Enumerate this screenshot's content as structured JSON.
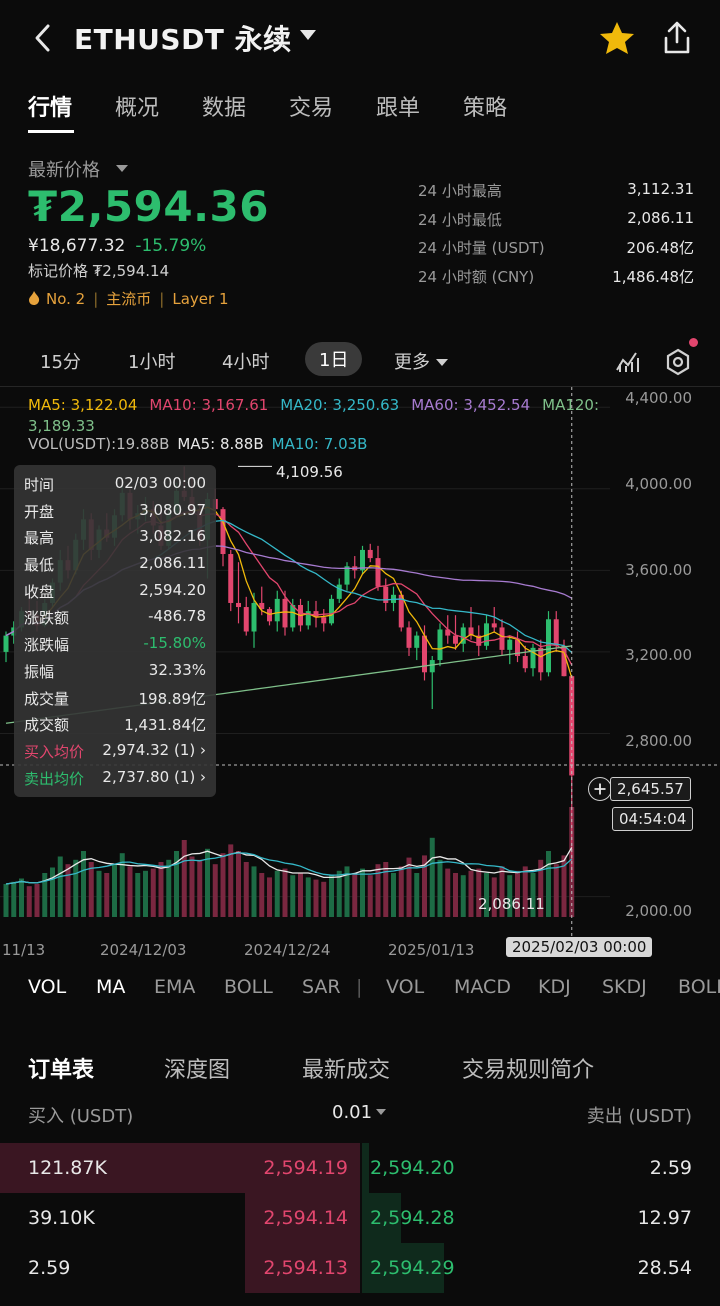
{
  "header": {
    "title": "ETHUSDT 永续"
  },
  "tabs": [
    "行情",
    "概况",
    "数据",
    "交易",
    "跟单",
    "策略"
  ],
  "ticker": {
    "latest_label": "最新价格",
    "last_price": "₮2,594.36",
    "cny_price": "¥18,677.32",
    "change_pct": "-15.79%",
    "mark_price": "标记价格 ₮2,594.14",
    "tag_rank": "No. 2",
    "tag_mainstream": "主流币",
    "tag_layer": "Layer 1",
    "sep": "|"
  },
  "stats": [
    {
      "label": "24 小时最高",
      "value": "3,112.31"
    },
    {
      "label": "24 小时最低",
      "value": "2,086.11"
    },
    {
      "label": "24 小时量 (USDT)",
      "value": "206.48亿"
    },
    {
      "label": "24 小时额 (CNY)",
      "value": "1,486.48亿"
    }
  ],
  "periods": {
    "p1": "15分",
    "p2": "1小时",
    "p3": "4小时",
    "p4": "1日",
    "more": "更多"
  },
  "ma_legend": {
    "ma5": "MA5: 3,122.04",
    "ma10": "MA10: 3,167.61",
    "ma20": "MA20: 3,250.63",
    "ma60": "MA60: 3,452.54",
    "ma120": "MA120: 3,189.33"
  },
  "vol_legend": {
    "vol": "VOL(USDT):19.88B",
    "ma5": "MA5: 8.88B",
    "ma10": "MA10: 7.03B"
  },
  "tooltip": [
    {
      "label": "时间",
      "value": "02/03 00:00"
    },
    {
      "label": "开盘",
      "value": "3,080.97"
    },
    {
      "label": "最高",
      "value": "3,082.16"
    },
    {
      "label": "最低",
      "value": "2,086.11"
    },
    {
      "label": "收盘",
      "value": "2,594.20"
    },
    {
      "label": "涨跌额",
      "value": "-486.78"
    },
    {
      "label": "涨跌幅",
      "value": "-15.80%"
    },
    {
      "label": "振幅",
      "value": "32.33%"
    },
    {
      "label": "成交量",
      "value": "198.89亿"
    },
    {
      "label": "成交额",
      "value": "1,431.84亿"
    },
    {
      "label": "买入均价",
      "value": "2,974.32 (1) ›"
    },
    {
      "label": "卖出均价",
      "value": "2,737.80 (1) ›"
    }
  ],
  "chart_labels": {
    "high": "4,109.56",
    "low": "2,086.11",
    "cross_price": "2,645.57",
    "cross_time": "04:54:04",
    "x_highlight": "2025/02/03 00:00"
  },
  "y_axis": [
    "4,400.00",
    "4,000.00",
    "3,600.00",
    "3,200.00",
    "2,800.00",
    "2,000.00"
  ],
  "x_axis": [
    "11/13",
    "2024/12/03",
    "2024/12/24",
    "2025/01/13"
  ],
  "indicators": [
    "VOL",
    "MA",
    "EMA",
    "BOLL",
    "SAR",
    "|",
    "VOL",
    "MACD",
    "KDJ",
    "SKDJ",
    "BOLL"
  ],
  "book_tabs": [
    "订单表",
    "深度图",
    "最新成交",
    "交易规则简介"
  ],
  "book_head": {
    "bid": "买入 (USDT)",
    "tick": "0.01",
    "ask": "卖出 (USDT)"
  },
  "book": [
    {
      "bid_qty": "121.87K",
      "bid_price": "2,594.19",
      "ask_price": "2,594.20",
      "ask_qty": "2.59",
      "bid_depth": 1.0,
      "ask_depth": 0.02
    },
    {
      "bid_qty": "39.10K",
      "bid_price": "2,594.14",
      "ask_price": "2,594.28",
      "ask_qty": "12.97",
      "bid_depth": 0.32,
      "ask_depth": 0.11
    },
    {
      "bid_qty": "2.59",
      "bid_price": "2,594.13",
      "ask_price": "2,594.29",
      "ask_qty": "28.54",
      "bid_depth": 0.32,
      "ask_depth": 0.23
    }
  ],
  "colors": {
    "up": "#2dbd6e",
    "down": "#e2466e",
    "ma5": "#f0b90b",
    "ma10": "#e2466e",
    "ma20": "#35b8c8",
    "ma60": "#a77bd0",
    "ma120": "#7fc08a"
  },
  "chart_data": {
    "type": "candlestick",
    "title": "",
    "ylim": [
      1900,
      4450
    ],
    "candles": [
      [
        3200,
        3300,
        3150,
        3280
      ],
      [
        3280,
        3350,
        3240,
        3320
      ],
      [
        3320,
        3420,
        3300,
        3400
      ],
      [
        3400,
        3480,
        3360,
        3380
      ],
      [
        3380,
        3450,
        3300,
        3330
      ],
      [
        3330,
        3460,
        3320,
        3440
      ],
      [
        3440,
        3560,
        3420,
        3540
      ],
      [
        3540,
        3700,
        3500,
        3650
      ],
      [
        3650,
        3720,
        3560,
        3600
      ],
      [
        3600,
        3780,
        3580,
        3750
      ],
      [
        3750,
        3900,
        3700,
        3850
      ],
      [
        3850,
        3880,
        3650,
        3700
      ],
      [
        3700,
        3820,
        3660,
        3800
      ],
      [
        3800,
        3880,
        3740,
        3760
      ],
      [
        3760,
        3900,
        3720,
        3870
      ],
      [
        3870,
        4020,
        3840,
        3980
      ],
      [
        3980,
        4000,
        3800,
        3850
      ],
      [
        3850,
        3920,
        3780,
        3880
      ],
      [
        3880,
        3960,
        3840,
        3900
      ],
      [
        3900,
        3940,
        3780,
        3820
      ],
      [
        3820,
        3900,
        3700,
        3720
      ],
      [
        3720,
        3920,
        3700,
        3880
      ],
      [
        3880,
        4030,
        3860,
        3990
      ],
      [
        3990,
        4110,
        3940,
        3960
      ],
      [
        3960,
        4050,
        3880,
        3900
      ],
      [
        3900,
        3930,
        3720,
        3750
      ],
      [
        3750,
        3980,
        3560,
        3950
      ],
      [
        3950,
        4000,
        3860,
        3900
      ],
      [
        3900,
        3910,
        3620,
        3680
      ],
      [
        3680,
        3700,
        3400,
        3440
      ],
      [
        3440,
        3640,
        3340,
        3420
      ],
      [
        3420,
        3470,
        3280,
        3300
      ],
      [
        3300,
        3490,
        3220,
        3440
      ],
      [
        3440,
        3520,
        3380,
        3410
      ],
      [
        3410,
        3420,
        3330,
        3350
      ],
      [
        3350,
        3500,
        3300,
        3460
      ],
      [
        3460,
        3500,
        3280,
        3320
      ],
      [
        3320,
        3460,
        3300,
        3430
      ],
      [
        3430,
        3460,
        3300,
        3330
      ],
      [
        3330,
        3450,
        3310,
        3400
      ],
      [
        3400,
        3450,
        3320,
        3370
      ],
      [
        3370,
        3410,
        3300,
        3340
      ],
      [
        3340,
        3480,
        3330,
        3460
      ],
      [
        3460,
        3560,
        3440,
        3530
      ],
      [
        3530,
        3640,
        3500,
        3620
      ],
      [
        3620,
        3670,
        3560,
        3600
      ],
      [
        3600,
        3720,
        3580,
        3700
      ],
      [
        3700,
        3730,
        3640,
        3660
      ],
      [
        3660,
        3720,
        3500,
        3520
      ],
      [
        3520,
        3560,
        3400,
        3440
      ],
      [
        3440,
        3520,
        3400,
        3480
      ],
      [
        3480,
        3500,
        3300,
        3320
      ],
      [
        3320,
        3350,
        3180,
        3220
      ],
      [
        3220,
        3300,
        3160,
        3280
      ],
      [
        3280,
        3330,
        3060,
        3100
      ],
      [
        3100,
        3180,
        2920,
        3160
      ],
      [
        3160,
        3340,
        3130,
        3310
      ],
      [
        3310,
        3380,
        3240,
        3280
      ],
      [
        3280,
        3380,
        3210,
        3240
      ],
      [
        3240,
        3340,
        3200,
        3320
      ],
      [
        3320,
        3420,
        3260,
        3280
      ],
      [
        3280,
        3330,
        3180,
        3230
      ],
      [
        3230,
        3380,
        3210,
        3340
      ],
      [
        3340,
        3420,
        3300,
        3320
      ],
      [
        3320,
        3360,
        3180,
        3210
      ],
      [
        3210,
        3280,
        3140,
        3260
      ],
      [
        3260,
        3300,
        3150,
        3180
      ],
      [
        3180,
        3230,
        3100,
        3120
      ],
      [
        3120,
        3240,
        3080,
        3220
      ],
      [
        3220,
        3260,
        3060,
        3100
      ],
      [
        3100,
        3400,
        3080,
        3360
      ],
      [
        3360,
        3400,
        3200,
        3230
      ],
      [
        3230,
        3260,
        3080,
        3081
      ]
    ],
    "last_candle": [
      3080.97,
      3082.16,
      2086.11,
      2594.2
    ],
    "volume": [
      0.3,
      0.32,
      0.35,
      0.28,
      0.3,
      0.4,
      0.45,
      0.55,
      0.48,
      0.52,
      0.6,
      0.5,
      0.42,
      0.4,
      0.48,
      0.58,
      0.46,
      0.4,
      0.42,
      0.44,
      0.5,
      0.52,
      0.6,
      0.7,
      0.55,
      0.52,
      0.62,
      0.48,
      0.58,
      0.66,
      0.6,
      0.5,
      0.46,
      0.4,
      0.36,
      0.42,
      0.44,
      0.38,
      0.4,
      0.36,
      0.34,
      0.32,
      0.38,
      0.42,
      0.46,
      0.4,
      0.44,
      0.38,
      0.48,
      0.5,
      0.4,
      0.46,
      0.54,
      0.4,
      0.56,
      0.72,
      0.52,
      0.44,
      0.4,
      0.38,
      0.42,
      0.44,
      0.4,
      0.36,
      0.46,
      0.38,
      0.42,
      0.46,
      0.4,
      0.52,
      0.6,
      0.48,
      0.56,
      1.0
    ]
  }
}
